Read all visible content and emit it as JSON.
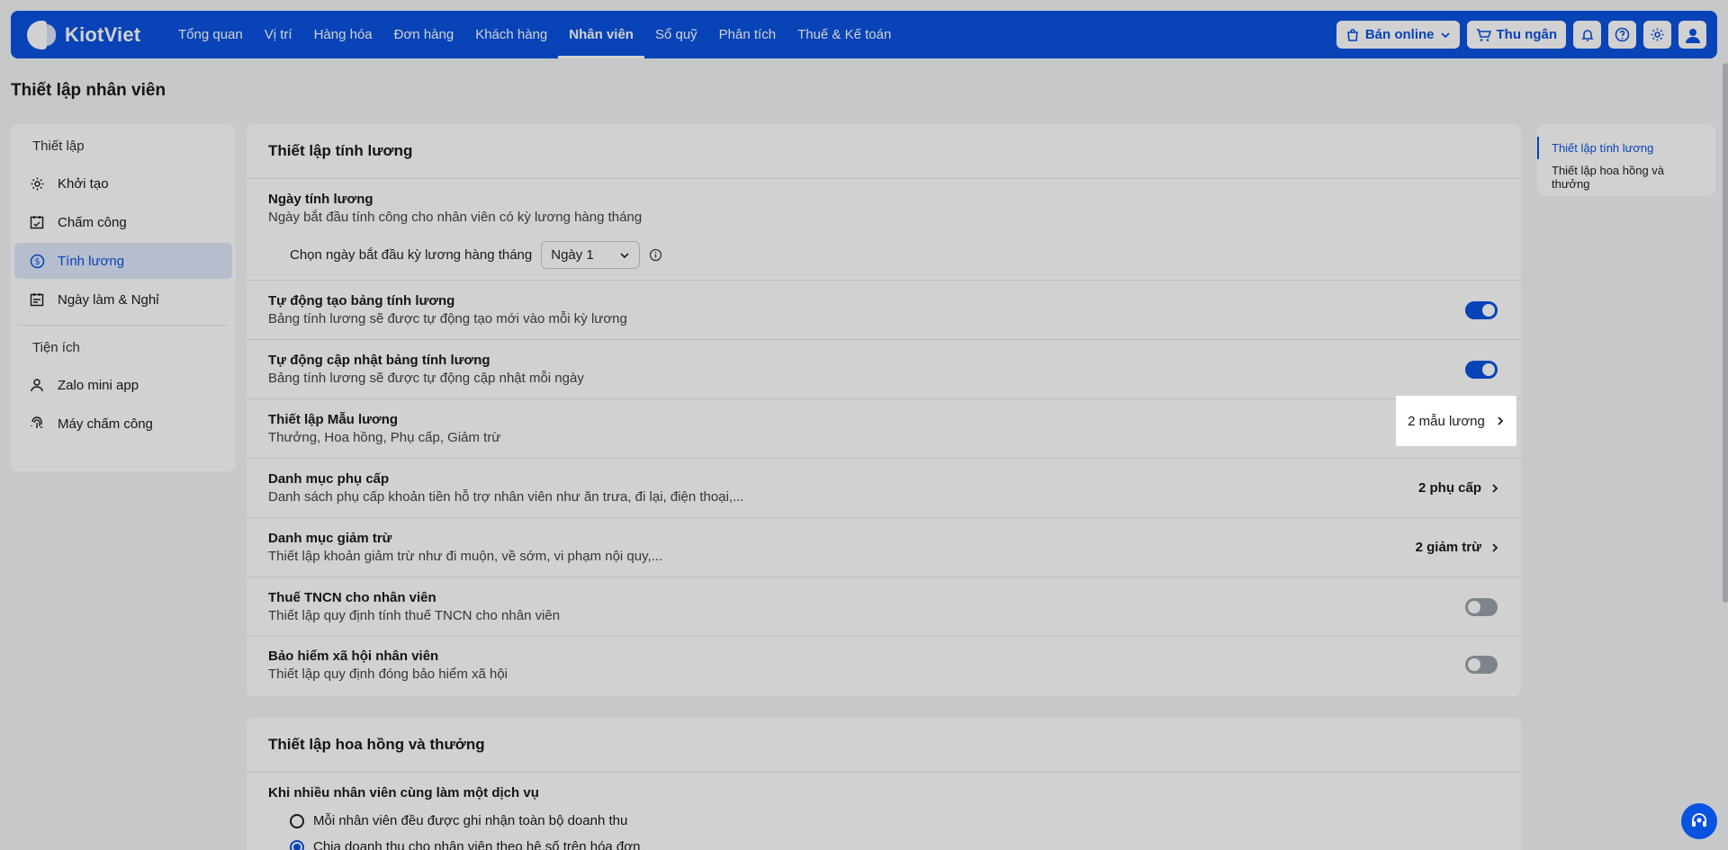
{
  "brand": {
    "name": "KiotViet"
  },
  "nav": {
    "items": [
      {
        "label": "Tổng quan"
      },
      {
        "label": "Vị trí"
      },
      {
        "label": "Hàng hóa"
      },
      {
        "label": "Đơn hàng"
      },
      {
        "label": "Khách hàng"
      },
      {
        "label": "Nhân viên",
        "active": true
      },
      {
        "label": "Sổ quỹ"
      },
      {
        "label": "Phân tích"
      },
      {
        "label": "Thuế & Kế toán"
      }
    ],
    "online_label": "Bán online",
    "cashier_label": "Thu ngân"
  },
  "page": {
    "title": "Thiết lập nhân viên"
  },
  "sidebar": {
    "setup_heading": "Thiết lập",
    "setup_items": [
      {
        "label": "Khởi tạo",
        "icon": "gear-icon"
      },
      {
        "label": "Chấm công",
        "icon": "calendar-check-icon"
      },
      {
        "label": "Tính lương",
        "icon": "dollar-circle-icon",
        "active": true
      },
      {
        "label": "Ngày làm & Nghỉ",
        "icon": "calendar-icon"
      }
    ],
    "utility_heading": "Tiện ích",
    "utility_items": [
      {
        "label": "Zalo mini app",
        "icon": "user-icon"
      },
      {
        "label": "Máy chấm công",
        "icon": "fingerprint-icon"
      }
    ]
  },
  "payroll": {
    "title": "Thiết lập tính lương",
    "pay_day": {
      "title": "Ngày tính lương",
      "desc": "Ngày bắt đầu tính công cho nhân viên có kỳ lương hàng tháng",
      "select_label": "Chọn ngày bắt đầu kỳ lương hàng tháng",
      "select_value": "Ngày 1"
    },
    "auto_create": {
      "title": "Tự động tạo bảng tính lương",
      "desc": "Bảng tính lương sẽ được tự động tạo mới vào mỗi kỳ lương",
      "on": true
    },
    "auto_update": {
      "title": "Tự động cập nhật bảng tính lương",
      "desc": "Bảng tính lương sẽ được tự động cập nhật mỗi ngày",
      "on": true
    },
    "templates": {
      "title": "Thiết lập Mẫu lương",
      "desc": "Thưởng, Hoa hồng, Phụ cấp, Giảm trừ",
      "value": "2 mẫu lương"
    },
    "allowances": {
      "title": "Danh mục phụ cấp",
      "desc": "Danh sách phụ cấp khoản tiền hỗ trợ nhân viên như ăn trưa, đi lại, điện thoại,...",
      "value": "2 phụ cấp"
    },
    "deductions": {
      "title": "Danh mục giảm trừ",
      "desc": "Thiết lập khoản giảm trừ như đi muộn, về sớm, vi phạm nội quy,...",
      "value": "2 giảm trừ"
    },
    "tax": {
      "title": "Thuế TNCN cho nhân viên",
      "desc": "Thiết lập quy định tính thuế TNCN cho nhân viên",
      "on": false
    },
    "insurance": {
      "title": "Bảo hiểm xã hội nhân viên",
      "desc": "Thiết lập quy định đóng bảo hiểm xã hội",
      "on": false
    }
  },
  "commission": {
    "title": "Thiết lập hoa hồng và thưởng",
    "question": "Khi nhiều nhân viên cùng làm một dịch vụ",
    "options": [
      {
        "label": "Mỗi nhân viên đều được ghi nhận toàn bộ doanh thu",
        "checked": false
      },
      {
        "label": "Chia doanh thu cho nhân viên theo hệ số trên hóa đơn",
        "checked": true
      }
    ]
  },
  "toc": {
    "items": [
      {
        "label": "Thiết lập tính lương",
        "active": true
      },
      {
        "label": "Thiết lập hoa hồng và thưởng"
      }
    ]
  },
  "colors": {
    "accent": "#0a52e0",
    "toggle_off": "#9aa1ab"
  }
}
